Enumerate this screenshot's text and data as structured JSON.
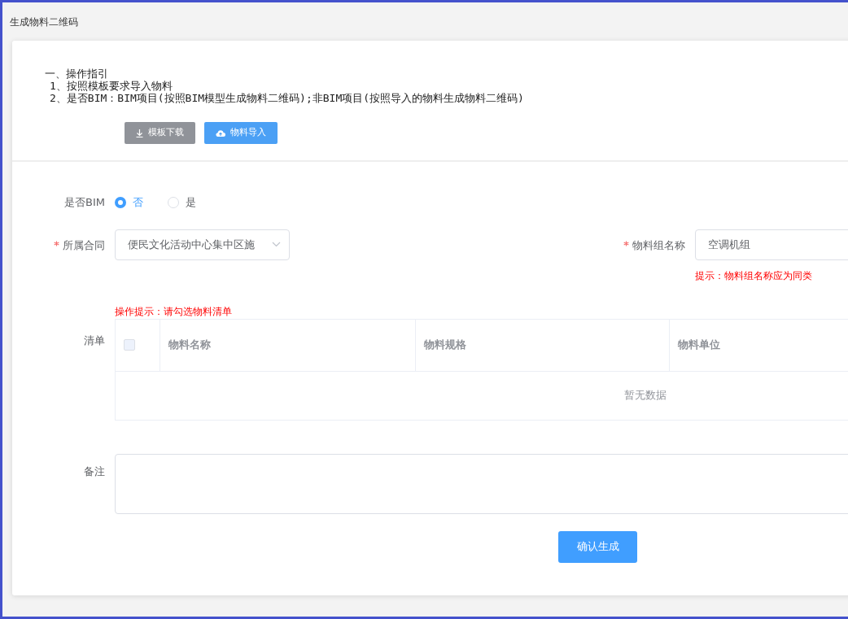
{
  "page_title": "生成物料二维码",
  "guide": {
    "heading": "一、操作指引",
    "steps": [
      "1、按照模板要求导入物料",
      "2、是否BIM：BIM项目(按照BIM模型生成物料二维码);非BIM项目(按照导入的物料生成物料二维码)"
    ]
  },
  "actions": [
    {
      "label": "模板下载",
      "kind": "download"
    },
    {
      "label": "物料导入",
      "kind": "upload"
    }
  ],
  "form": {
    "bim": {
      "label": "是否BIM",
      "options": [
        {
          "label": "否",
          "selected": true
        },
        {
          "label": "是",
          "selected": false
        }
      ]
    },
    "contract": {
      "label": "所属合同",
      "required": true,
      "value": "便民文化活动中心集中区施"
    },
    "material_group": {
      "label": "物料组名称",
      "required": true,
      "value": "空调机组",
      "hint": "提示：物料组名称应为同类"
    },
    "list": {
      "label": "清单",
      "tip": "操作提示：请勾选物料清单",
      "columns": [
        "物料名称",
        "物料规格",
        "物料单位"
      ],
      "all_checked": false,
      "empty_text": "暂无数据"
    },
    "remark": {
      "label": "备注"
    },
    "submit": "确认生成"
  }
}
